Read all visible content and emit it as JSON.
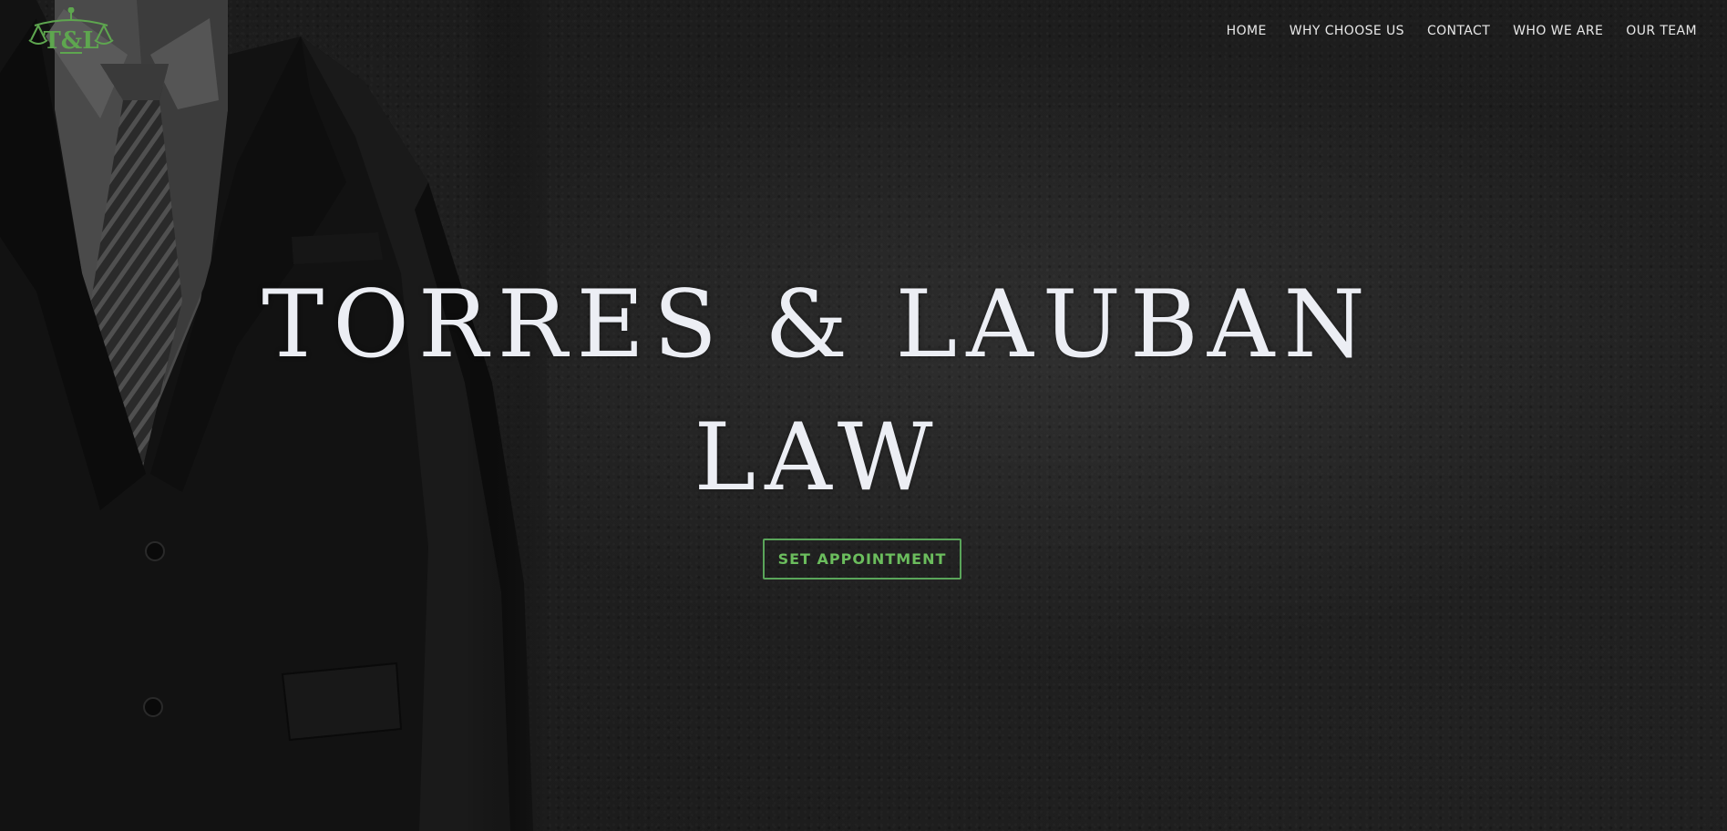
{
  "logo": {
    "text": "T&L",
    "icon": "scales-of-justice-icon",
    "color": "#5ea64f"
  },
  "nav": {
    "items": [
      {
        "label": "HOME"
      },
      {
        "label": "WHY CHOOSE US"
      },
      {
        "label": "CONTACT"
      },
      {
        "label": "WHO WE ARE"
      },
      {
        "label": "OUR TEAM"
      }
    ]
  },
  "hero": {
    "title_line1": "TORRES & LAUBAN",
    "title_line2": "LAW",
    "cta_label": "SET APPOINTMENT",
    "accent_color": "#5aa55a",
    "background_image": "man-in-dark-suit-and-tie"
  }
}
